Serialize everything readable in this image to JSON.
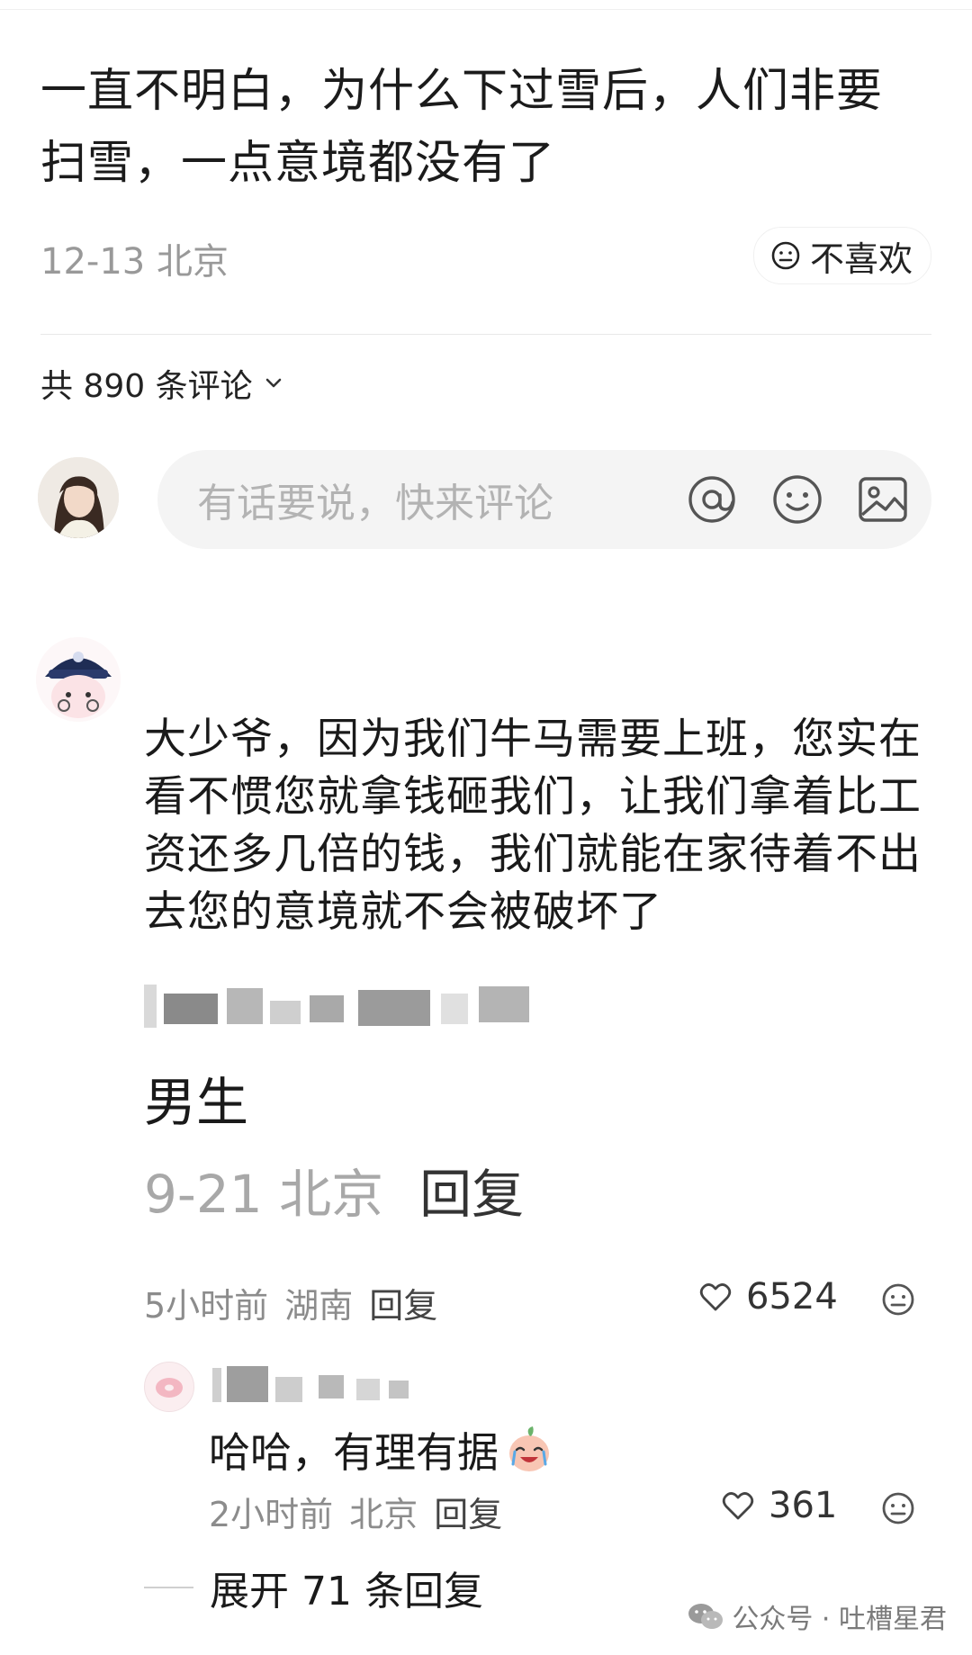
{
  "post": {
    "title": "一直不明白，为什么下过雪后，人们非要扫雪，一点意境都没有了",
    "date": "12-13",
    "location": "北京",
    "dislike_label": "不喜欢"
  },
  "comments_header": {
    "count_label": "共 890 条评论"
  },
  "composer": {
    "placeholder": "有话要说，快来评论"
  },
  "comment": {
    "text": "大少爷，因为我们牛马需要上班，您实在看不惯您就拿钱砸我们，让我们拿着比工资还多几倍的钱，我们就能在家待着不出去您的意境就不会被破坏了",
    "quoted_name": "男生",
    "quoted_date": "9-21",
    "quoted_location": "北京",
    "quoted_reply": "回复",
    "time": "5小时前",
    "location": "湖南",
    "reply_label": "回复",
    "likes": "6524"
  },
  "reply": {
    "text": "哈哈，有理有据",
    "time": "2小时前",
    "location": "北京",
    "reply_label": "回复",
    "likes": "361"
  },
  "expand": {
    "label": "展开 71 条回复"
  },
  "watermark": {
    "text": "公众号 · 吐槽星君"
  },
  "icons": {
    "dislike": "neutral-face-icon",
    "chevron": "chevron-down-icon",
    "at": "at-icon",
    "emoji": "smiley-icon",
    "image": "image-icon",
    "heart": "heart-icon",
    "wechat": "wechat-icon"
  }
}
